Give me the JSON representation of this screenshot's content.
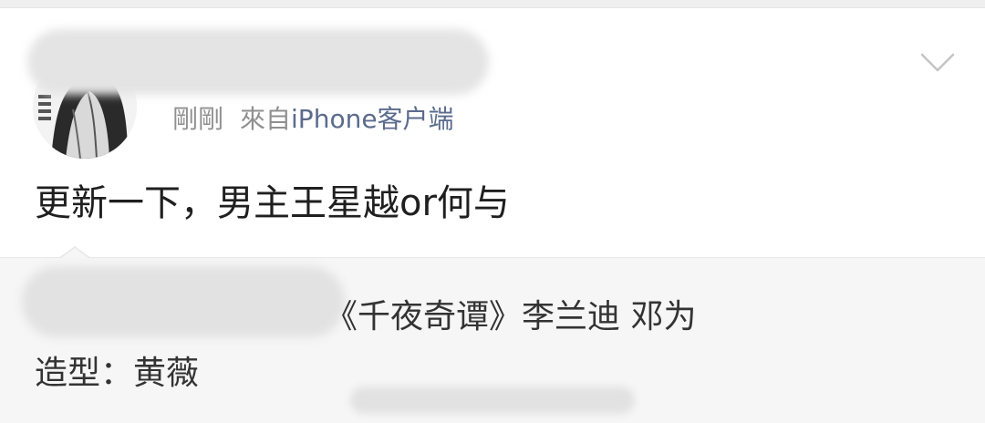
{
  "post": {
    "time": "剛剛",
    "source_prefix": "來自",
    "source": "iPhone客户端",
    "text": "更新一下，男主王星越or何与"
  },
  "repost": {
    "line1": "《千夜奇谭》李兰迪 邓为",
    "line2": "造型：黄薇"
  },
  "icons": {
    "expand": "chevron-down-icon"
  },
  "colors": {
    "meta_gray": "#8f8f8f",
    "source_blue": "#5b6b8c",
    "body_text": "#1f1f1f",
    "repost_bg": "#f6f6f6"
  }
}
